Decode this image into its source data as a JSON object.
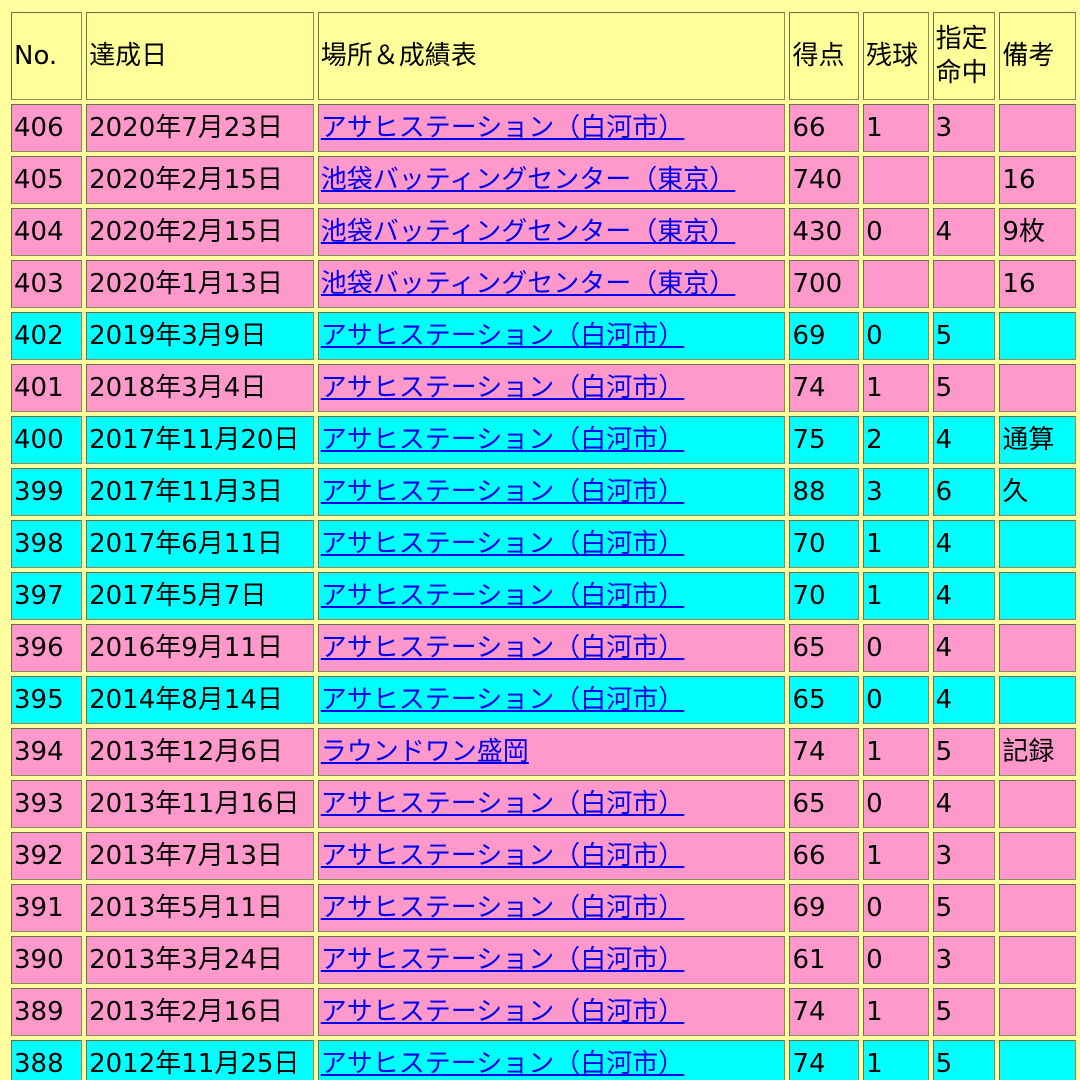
{
  "headers": {
    "no": "No.",
    "date": "達成日",
    "venue": "場所＆成績表",
    "score": "得点",
    "remaining": "残球",
    "designated_line1": "指定",
    "designated_line2": "命中",
    "note": "備考"
  },
  "colors": {
    "background": "#ffffa0",
    "header_cell": "#ffff99",
    "pink_row": "#ff99cc",
    "cyan_row": "#00ffff",
    "link": "#0000ee"
  },
  "rows": [
    {
      "no": "406",
      "date": "2020年7月23日",
      "venue": "アサヒステーション（白河市）",
      "score": "66",
      "remaining": "1",
      "hit": "3",
      "note": "",
      "color": "pink"
    },
    {
      "no": "405",
      "date": "2020年2月15日",
      "venue": "池袋バッティングセンター（東京）",
      "score": "740",
      "remaining": "",
      "hit": "",
      "note": "16",
      "color": "pink"
    },
    {
      "no": "404",
      "date": "2020年2月15日",
      "venue": "池袋バッティングセンター（東京）",
      "score": "430",
      "remaining": "0",
      "hit": "4",
      "note": "9枚",
      "color": "pink"
    },
    {
      "no": "403",
      "date": "2020年1月13日",
      "venue": "池袋バッティングセンター（東京）",
      "score": "700",
      "remaining": "",
      "hit": "",
      "note": "16",
      "color": "pink"
    },
    {
      "no": "402",
      "date": "2019年3月9日",
      "venue": "アサヒステーション（白河市）",
      "score": "69",
      "remaining": "0",
      "hit": "5",
      "note": "",
      "color": "cyan"
    },
    {
      "no": "401",
      "date": "2018年3月4日",
      "venue": "アサヒステーション（白河市）",
      "score": "74",
      "remaining": "1",
      "hit": "5",
      "note": "",
      "color": "pink"
    },
    {
      "no": "400",
      "date": "2017年11月20日",
      "venue": "アサヒステーション（白河市）",
      "score": "75",
      "remaining": "2",
      "hit": "4",
      "note": "通算",
      "color": "cyan"
    },
    {
      "no": "399",
      "date": "2017年11月3日",
      "venue": "アサヒステーション（白河市）",
      "score": "88",
      "remaining": "3",
      "hit": "6",
      "note": "久",
      "color": "cyan"
    },
    {
      "no": "398",
      "date": "2017年6月11日",
      "venue": "アサヒステーション（白河市）",
      "score": "70",
      "remaining": "1",
      "hit": "4",
      "note": "",
      "color": "cyan"
    },
    {
      "no": "397",
      "date": "2017年5月7日",
      "venue": "アサヒステーション（白河市）",
      "score": "70",
      "remaining": "1",
      "hit": "4",
      "note": "",
      "color": "cyan"
    },
    {
      "no": "396",
      "date": "2016年9月11日",
      "venue": "アサヒステーション（白河市）",
      "score": "65",
      "remaining": "0",
      "hit": "4",
      "note": "",
      "color": "pink"
    },
    {
      "no": "395",
      "date": "2014年8月14日",
      "venue": "アサヒステーション（白河市）",
      "score": "65",
      "remaining": "0",
      "hit": "4",
      "note": "",
      "color": "cyan"
    },
    {
      "no": "394",
      "date": "2013年12月6日",
      "venue": "ラウンドワン盛岡",
      "score": "74",
      "remaining": "1",
      "hit": "5",
      "note": "記録",
      "color": "pink"
    },
    {
      "no": "393",
      "date": "2013年11月16日",
      "venue": "アサヒステーション（白河市）",
      "score": "65",
      "remaining": "0",
      "hit": "4",
      "note": "",
      "color": "pink"
    },
    {
      "no": "392",
      "date": "2013年7月13日",
      "venue": "アサヒステーション（白河市）",
      "score": "66",
      "remaining": "1",
      "hit": "3",
      "note": "",
      "color": "pink"
    },
    {
      "no": "391",
      "date": "2013年5月11日",
      "venue": "アサヒステーション（白河市）",
      "score": "69",
      "remaining": "0",
      "hit": "5",
      "note": "",
      "color": "pink"
    },
    {
      "no": "390",
      "date": "2013年3月24日",
      "venue": "アサヒステーション（白河市）",
      "score": "61",
      "remaining": "0",
      "hit": "3",
      "note": "",
      "color": "pink"
    },
    {
      "no": "389",
      "date": "2013年2月16日",
      "venue": "アサヒステーション（白河市）",
      "score": "74",
      "remaining": "1",
      "hit": "5",
      "note": "",
      "color": "pink"
    },
    {
      "no": "388",
      "date": "2012年11月25日",
      "venue": "アサヒステーション（白河市）",
      "score": "74",
      "remaining": "1",
      "hit": "5",
      "note": "",
      "color": "cyan"
    }
  ]
}
